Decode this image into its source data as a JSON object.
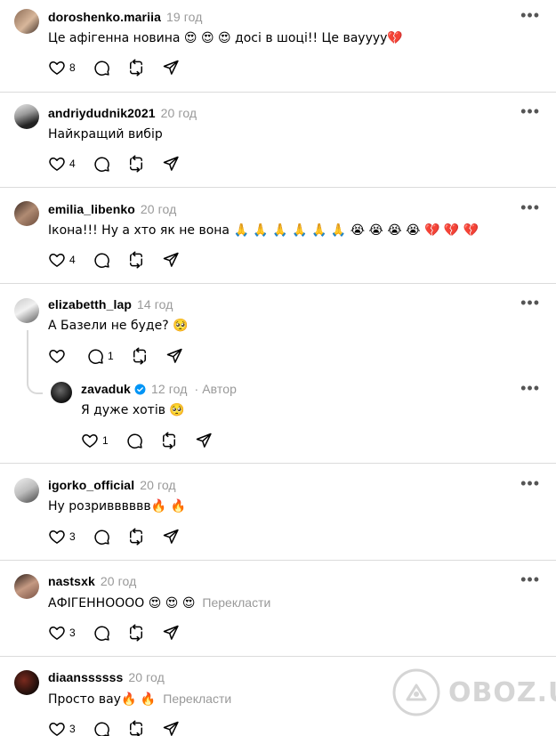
{
  "comments": [
    {
      "username": "doroshenko.mariia",
      "time": "19 год",
      "text": "Це афігенна новина 😍 😍 😍 досі в шоці!! Це вауууу💔",
      "likes": "8",
      "replies": "",
      "translate": ""
    },
    {
      "username": "andriydudnik2021",
      "time": "20 год",
      "text": "Найкращий вибір",
      "likes": "4",
      "replies": "",
      "translate": ""
    },
    {
      "username": "emilia_libenko",
      "time": "20 год",
      "text": "Ікона!!! Ну а хто як не вона 🙏 🙏 🙏 🙏 🙏 🙏 😭 😭 😭 😭 💔 💔 💔",
      "likes": "4",
      "replies": "",
      "translate": ""
    },
    {
      "username": "elizabetth_lap",
      "time": "14 год",
      "text": "А Базели не буде? 🥺",
      "likes": "",
      "replies": "1",
      "translate": ""
    },
    {
      "username": "igorko_official",
      "time": "20 год",
      "text": "Ну розривввввв🔥 🔥",
      "likes": "3",
      "replies": "",
      "translate": ""
    },
    {
      "username": "nastsxk",
      "time": "20 год",
      "text": "АФІГЕННОООО 😍 😍 😍",
      "likes": "3",
      "replies": "",
      "translate": "Перекласти"
    },
    {
      "username": "diaanssssss",
      "time": "20 год",
      "text": "Просто вау🔥 🔥",
      "likes": "3",
      "replies": "",
      "translate": "Перекласти"
    }
  ],
  "reply": {
    "username": "zavaduk",
    "time": "12 год",
    "author_label": "Автор",
    "separator": "·",
    "text": "Я дуже хотів 🥺",
    "likes": "1"
  },
  "more_label": "•••",
  "watermark": {
    "text": "OBOZ.UA"
  },
  "colors": {
    "muted": "#999999",
    "divider": "#dbdbdb",
    "verified": "#0095f6"
  },
  "icons": [
    "heart-icon",
    "comment-icon",
    "repost-icon",
    "share-icon",
    "more-icon",
    "verified-icon"
  ]
}
